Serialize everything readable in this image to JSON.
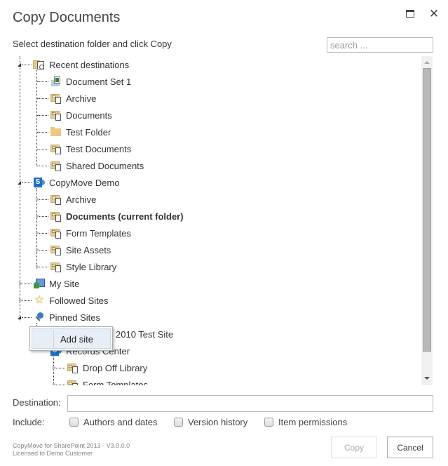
{
  "dialog": {
    "title": "Copy Documents",
    "maximize_icon": "maximize-icon",
    "close_icon": "close-icon",
    "close_glyph": "✕",
    "instruction": "Select destination folder and click Copy",
    "search_placeholder": "search ...",
    "search_value": ""
  },
  "tree": {
    "recent": {
      "label": "Recent destinations",
      "icon": "recent-destinations-icon",
      "expanded": true,
      "children": [
        {
          "label": "Document Set 1",
          "icon": "document-set-icon"
        },
        {
          "label": "Archive",
          "icon": "library-icon"
        },
        {
          "label": "Documents",
          "icon": "library-icon"
        },
        {
          "label": "Test Folder",
          "icon": "folder-icon"
        },
        {
          "label": "Test Documents",
          "icon": "library-icon"
        },
        {
          "label": "Shared Documents",
          "icon": "library-icon"
        }
      ]
    },
    "site": {
      "label": "CopyMove Demo",
      "icon": "sharepoint-site-icon",
      "expanded": true,
      "children": [
        {
          "label": "Archive",
          "icon": "library-icon"
        },
        {
          "label": "Documents (current folder)",
          "icon": "library-icon",
          "current": true
        },
        {
          "label": "Form Templates",
          "icon": "library-icon"
        },
        {
          "label": "Site Assets",
          "icon": "library-icon"
        },
        {
          "label": "Style Library",
          "icon": "library-icon"
        }
      ]
    },
    "my_site": {
      "label": "My Site",
      "icon": "my-site-icon"
    },
    "followed": {
      "label": "Followed Sites",
      "icon": "star-icon",
      "glyph": "☆"
    },
    "pinned": {
      "label": "Pinned Sites",
      "icon": "pin-icon",
      "expanded": true,
      "children": [
        {
          "label": "SP 2010 Test Site",
          "visible_label": "2010 Test Site",
          "icon": "sharepoint-site-icon"
        },
        {
          "label": "Records Center",
          "icon": "sharepoint-site-icon",
          "children": [
            {
              "label": "Drop Off Library",
              "icon": "library-icon"
            },
            {
              "label": "Form Templates",
              "icon": "library-icon"
            }
          ]
        }
      ]
    }
  },
  "context_menu": {
    "items": [
      {
        "label": "Add site"
      }
    ]
  },
  "form": {
    "destination_label": "Destination:",
    "destination_value": "",
    "include_label": "Include:",
    "options": [
      {
        "label": "Authors and dates",
        "checked": false
      },
      {
        "label": "Version history",
        "checked": false
      },
      {
        "label": "Item permissions",
        "checked": false
      }
    ]
  },
  "footer": {
    "product": "CopyMove for SharePoint 2013 - V3.0.0.0",
    "license": "Licensed to Demo Customer"
  },
  "buttons": {
    "copy": "Copy",
    "copy_enabled": false,
    "cancel": "Cancel"
  }
}
